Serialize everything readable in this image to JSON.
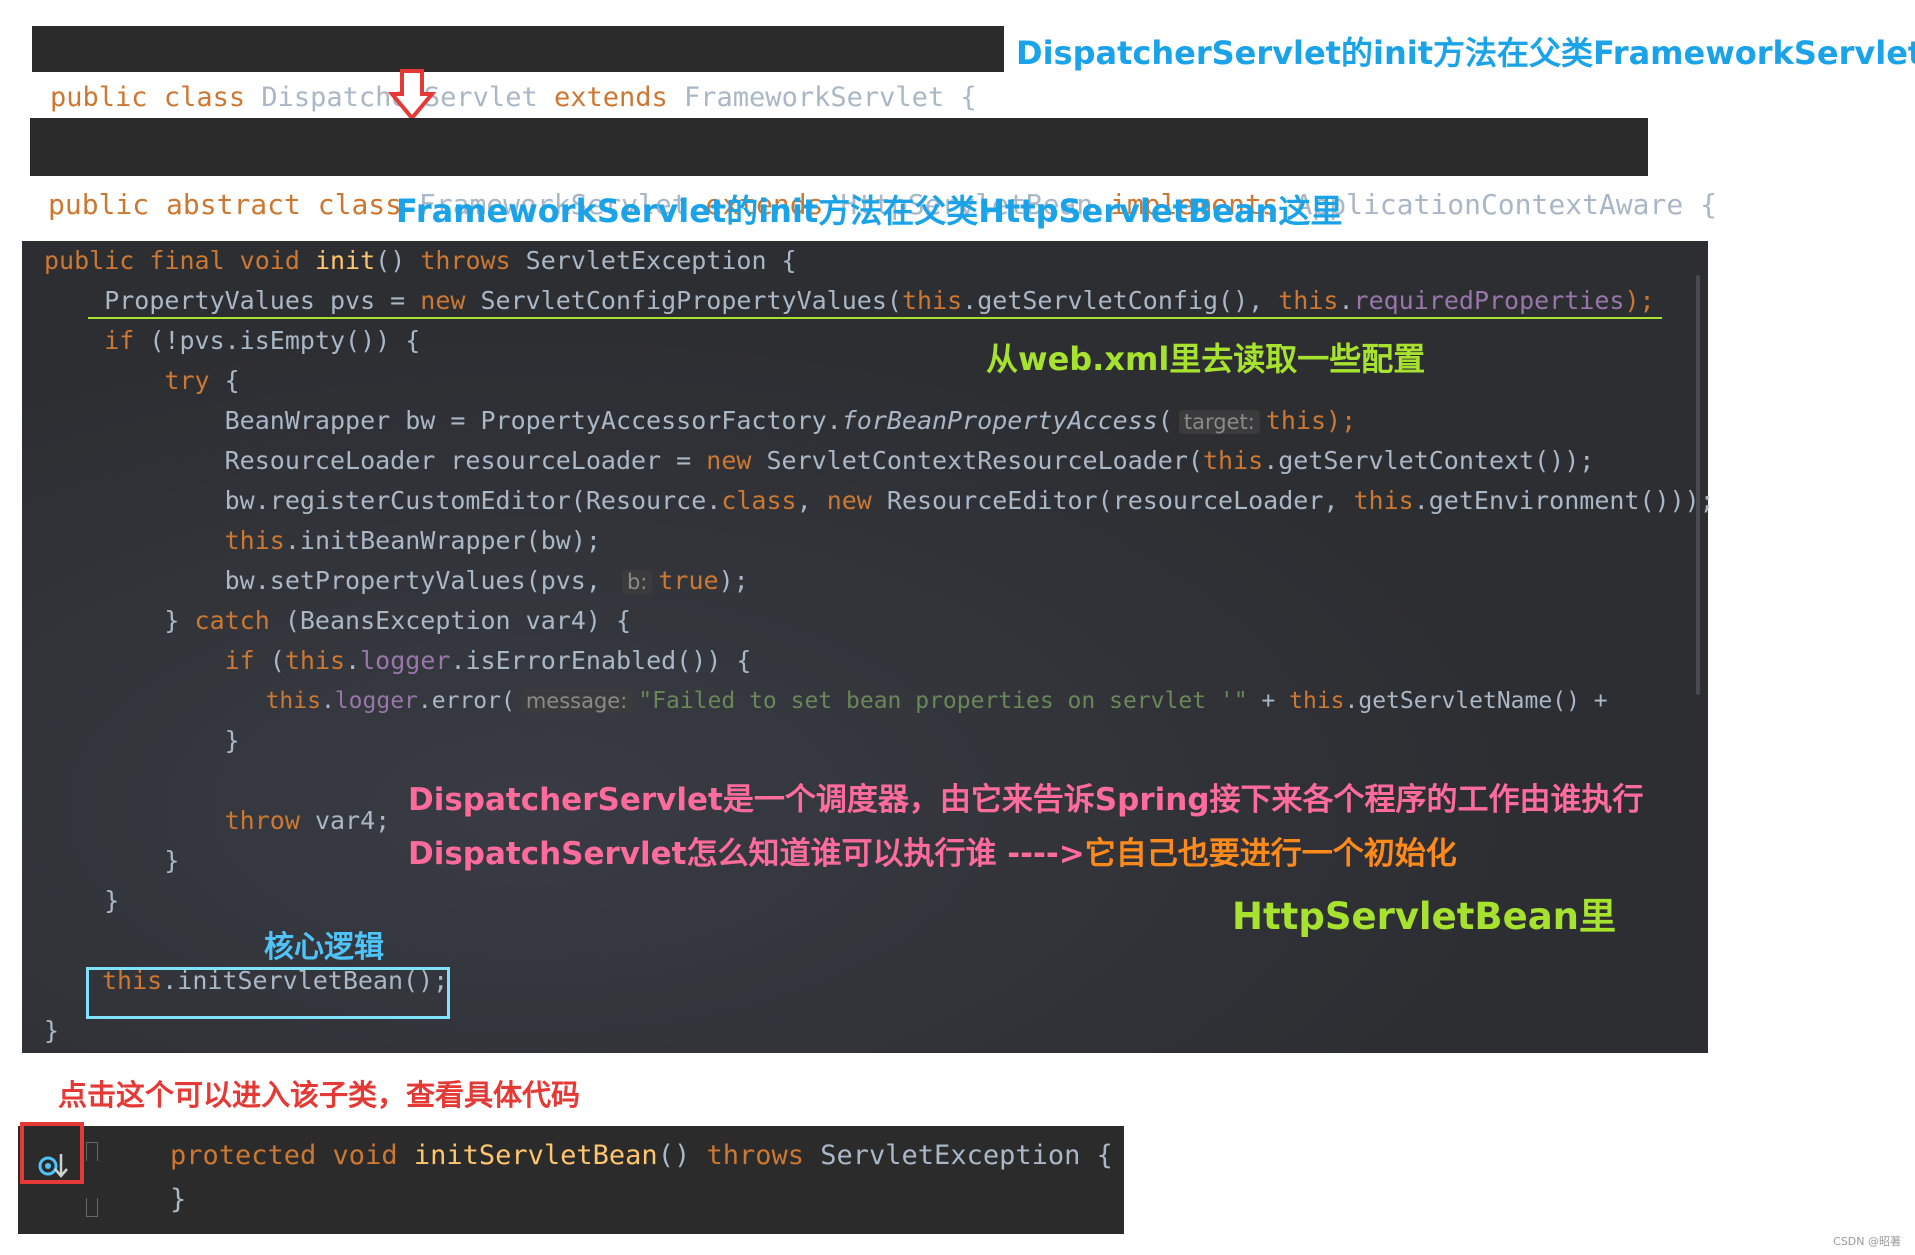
{
  "strip1": {
    "public": "public",
    "class": "class",
    "name": "DispatcherServlet",
    "extends": "extends",
    "parent": "FrameworkServlet",
    "brace": "{"
  },
  "strip2": {
    "public": "public",
    "abstract": "abstract",
    "class": "class",
    "name": "FrameworkServlet",
    "extends": "extends",
    "parent": "HttpServletBean",
    "implements": "implements",
    "iface": "ApplicationContextAware",
    "brace": "{"
  },
  "annotations": {
    "a1": "DispatcherServlet的init方法在父类FrameworkServlet这里",
    "a2": "FrameworkServlet的init方法在父类HttpServletBean这里",
    "a3": "从web.xml里去读取一些配置",
    "a4": "DispatcherServlet是一个调度器，由它来告诉Spring接下来各个程序的工作由谁执行",
    "a5a": "DispatchServlet怎么知道谁可以执行谁 ---->",
    "a5b": "它自己也要进行一个初始化",
    "a6": "HttpServletBean里",
    "a7": "核心逻辑",
    "a8": "点击这个可以进入该子类，查看具体代码",
    "watermark": "CSDN @昭著"
  },
  "code": {
    "l1": {
      "a": "public final void",
      "b": "init",
      "c": "() ",
      "d": "throws",
      "e": " ServletException {"
    },
    "l2": {
      "a": "    PropertyValues pvs = ",
      "b": "new",
      "c": " ServletConfigPropertyValues(",
      "d": "this",
      ".e": "",
      "e": ".getServletConfig(), ",
      "f": "this",
      "g": ".",
      "h": "requiredProperties",
      "i": ");"
    },
    "l3": {
      "a": "    ",
      "b": "if",
      "c": " (!pvs.isEmpty()) {"
    },
    "l4": {
      "a": "        ",
      "b": "try",
      "c": " {"
    },
    "l5": {
      "a": "            BeanWrapper bw = PropertyAccessorFactory.",
      "b": "forBeanPropertyAccess",
      "c": "(",
      "hint": "target:",
      "d": "this",
      "e": ");"
    },
    "l6": {
      "a": "            ResourceLoader resourceLoader = ",
      "b": "new",
      "c": " ServletContextResourceLoader(",
      "d": "this",
      "e": ".getServletContext());"
    },
    "l7": {
      "a": "            bw.registerCustomEditor(Resource.",
      "b": "class",
      "c": ", ",
      "d": "new",
      "e": " ResourceEditor(resourceLoader, ",
      "f": "this",
      "g": ".getEnvironment()));"
    },
    "l8": {
      "a": "            ",
      "b": "this",
      "c": ".initBeanWrapper(bw);"
    },
    "l9": {
      "a": "            bw.setPropertyValues(pvs, ",
      "hint": "b:",
      "b": "true",
      "c": ");"
    },
    "l10": {
      "a": "        } ",
      "b": "catch",
      "c": " (BeansException var4) {"
    },
    "l11": {
      "a": "            ",
      "b": "if",
      "c": " (",
      "d": "this",
      "e": ".",
      "f": "logger",
      "g": ".isErrorEnabled()) {"
    },
    "l12": {
      "a": "                ",
      "b": "this",
      "c": ".",
      "d": "logger",
      "e": ".error(",
      "hint": "message:",
      "f": "\"Failed to set bean properties on servlet '\"",
      "g": " + ",
      "h": "this",
      "i": ".getServletName() +"
    },
    "l13": {
      "a": "            }"
    },
    "l14": {
      "a": "            ",
      "b": "throw",
      "c": " var4;"
    },
    "l15": {
      "a": "        }"
    },
    "l16": {
      "a": "    }"
    },
    "l17": {
      "a": "this",
      "b": ".initServletBean();"
    },
    "l18": {
      "a": "}"
    }
  },
  "bottom": {
    "a": "protected void",
    "b": "initServletBean",
    "c": "() ",
    "d": "throws",
    "e": " ServletException {",
    "f": "}"
  },
  "colors": {
    "code_bg": "#2b2b2b",
    "keyword": "#cc7832",
    "method": "#ffc66d",
    "field": "#9876aa",
    "string": "#6a8759",
    "ann_blue": "#1aa3e8",
    "ann_green": "#a6e22e",
    "ann_pink": "#ff6b9b",
    "ann_orange": "#ff8a1c",
    "ann_red": "#e53935"
  }
}
